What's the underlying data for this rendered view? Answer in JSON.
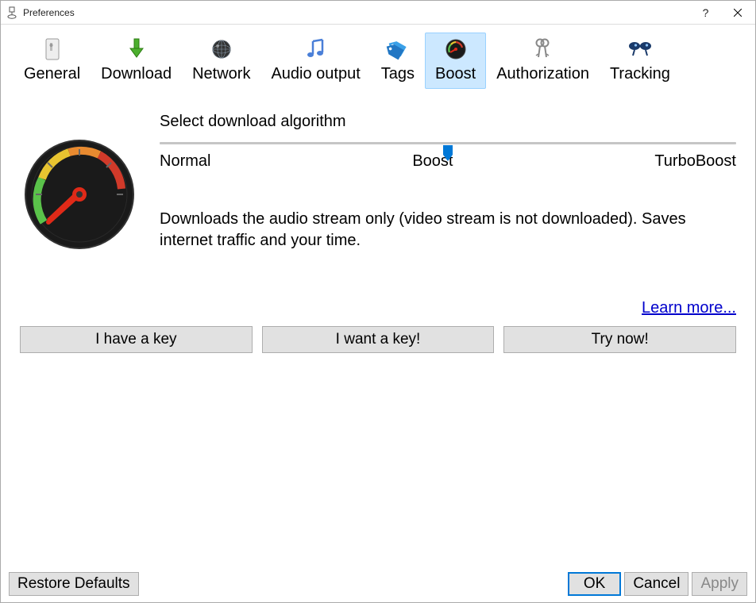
{
  "window": {
    "title": "Preferences"
  },
  "tabs": {
    "general": "General",
    "download": "Download",
    "network": "Network",
    "audio": "Audio output",
    "tags": "Tags",
    "boost": "Boost",
    "authorization": "Authorization",
    "tracking": "Tracking"
  },
  "boost": {
    "section_label": "Select download algorithm",
    "slider": {
      "left": "Normal",
      "mid": "Boost",
      "right": "TurboBoost"
    },
    "description": "Downloads the audio stream only (video stream is not downloaded). Saves internet traffic and your time.",
    "learn_more": "Learn more..."
  },
  "key_buttons": {
    "have_key": "I have a key",
    "want_key": "I want a key!",
    "try_now": "Try now!"
  },
  "bottom": {
    "restore": "Restore Defaults",
    "ok": "OK",
    "cancel": "Cancel",
    "apply": "Apply"
  }
}
